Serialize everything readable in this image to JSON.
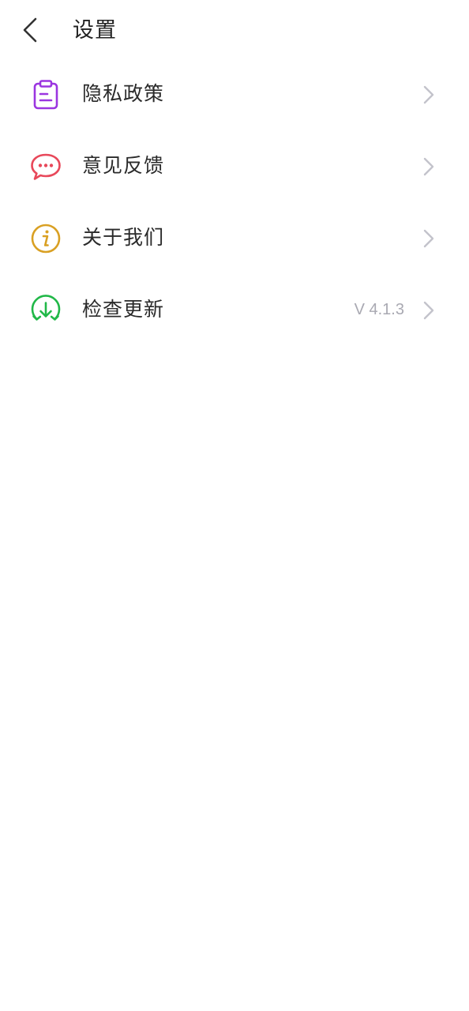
{
  "header": {
    "title": "设置",
    "back_icon": "chevron-left-icon"
  },
  "menu": {
    "items": [
      {
        "label": "隐私政策",
        "icon": "clipboard-icon",
        "color": "#9b35e0",
        "value": ""
      },
      {
        "label": "意见反馈",
        "icon": "chat-bubble-icon",
        "color": "#e8485a",
        "value": ""
      },
      {
        "label": "关于我们",
        "icon": "info-icon",
        "color": "#d9a023",
        "value": ""
      },
      {
        "label": "检查更新",
        "icon": "download-refresh-icon",
        "color": "#21b848",
        "value": "V 4.1.3"
      }
    ],
    "chevron_icon": "chevron-right-icon",
    "chevron_color": "#c3c3cb"
  }
}
